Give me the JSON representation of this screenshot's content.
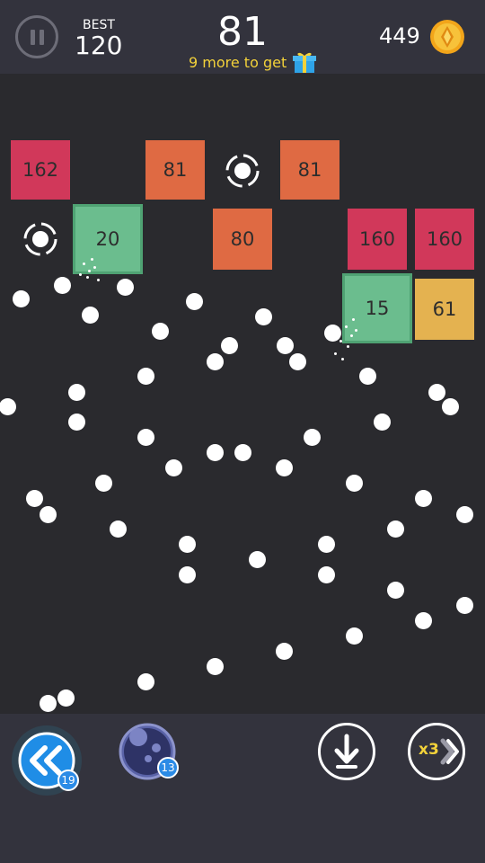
{
  "header": {
    "best_label": "BEST",
    "best_value": "120",
    "score": "81",
    "gift_text": "9 more to get",
    "coins": "449"
  },
  "blocks": [
    {
      "value": "162",
      "color": "red"
    },
    {
      "value": "81",
      "color": "orange"
    },
    {
      "value": "81",
      "color": "orange"
    },
    {
      "value": "20",
      "color": "green"
    },
    {
      "value": "80",
      "color": "orange"
    },
    {
      "value": "160",
      "color": "red"
    },
    {
      "value": "160",
      "color": "red"
    },
    {
      "value": "15",
      "color": "green"
    },
    {
      "value": "61",
      "color": "yellow"
    }
  ],
  "footer": {
    "rewind_count": "19",
    "bomb_count": "13",
    "speed_label": "x3"
  },
  "colors": {
    "background": "#2a2a2e",
    "bar": "#33333d",
    "red_block": "#d1385a",
    "orange_block": "#df6a43",
    "green_block": "#6bbd8e",
    "yellow_block": "#e4b250",
    "accent_blue": "#2b8be6",
    "gold": "#f3d23a"
  },
  "icons": [
    "pause-icon",
    "gift-icon",
    "coin-icon",
    "target-ring-icon",
    "rewind-icon",
    "bomb-icon",
    "drop-down-icon",
    "speed-icon"
  ]
}
